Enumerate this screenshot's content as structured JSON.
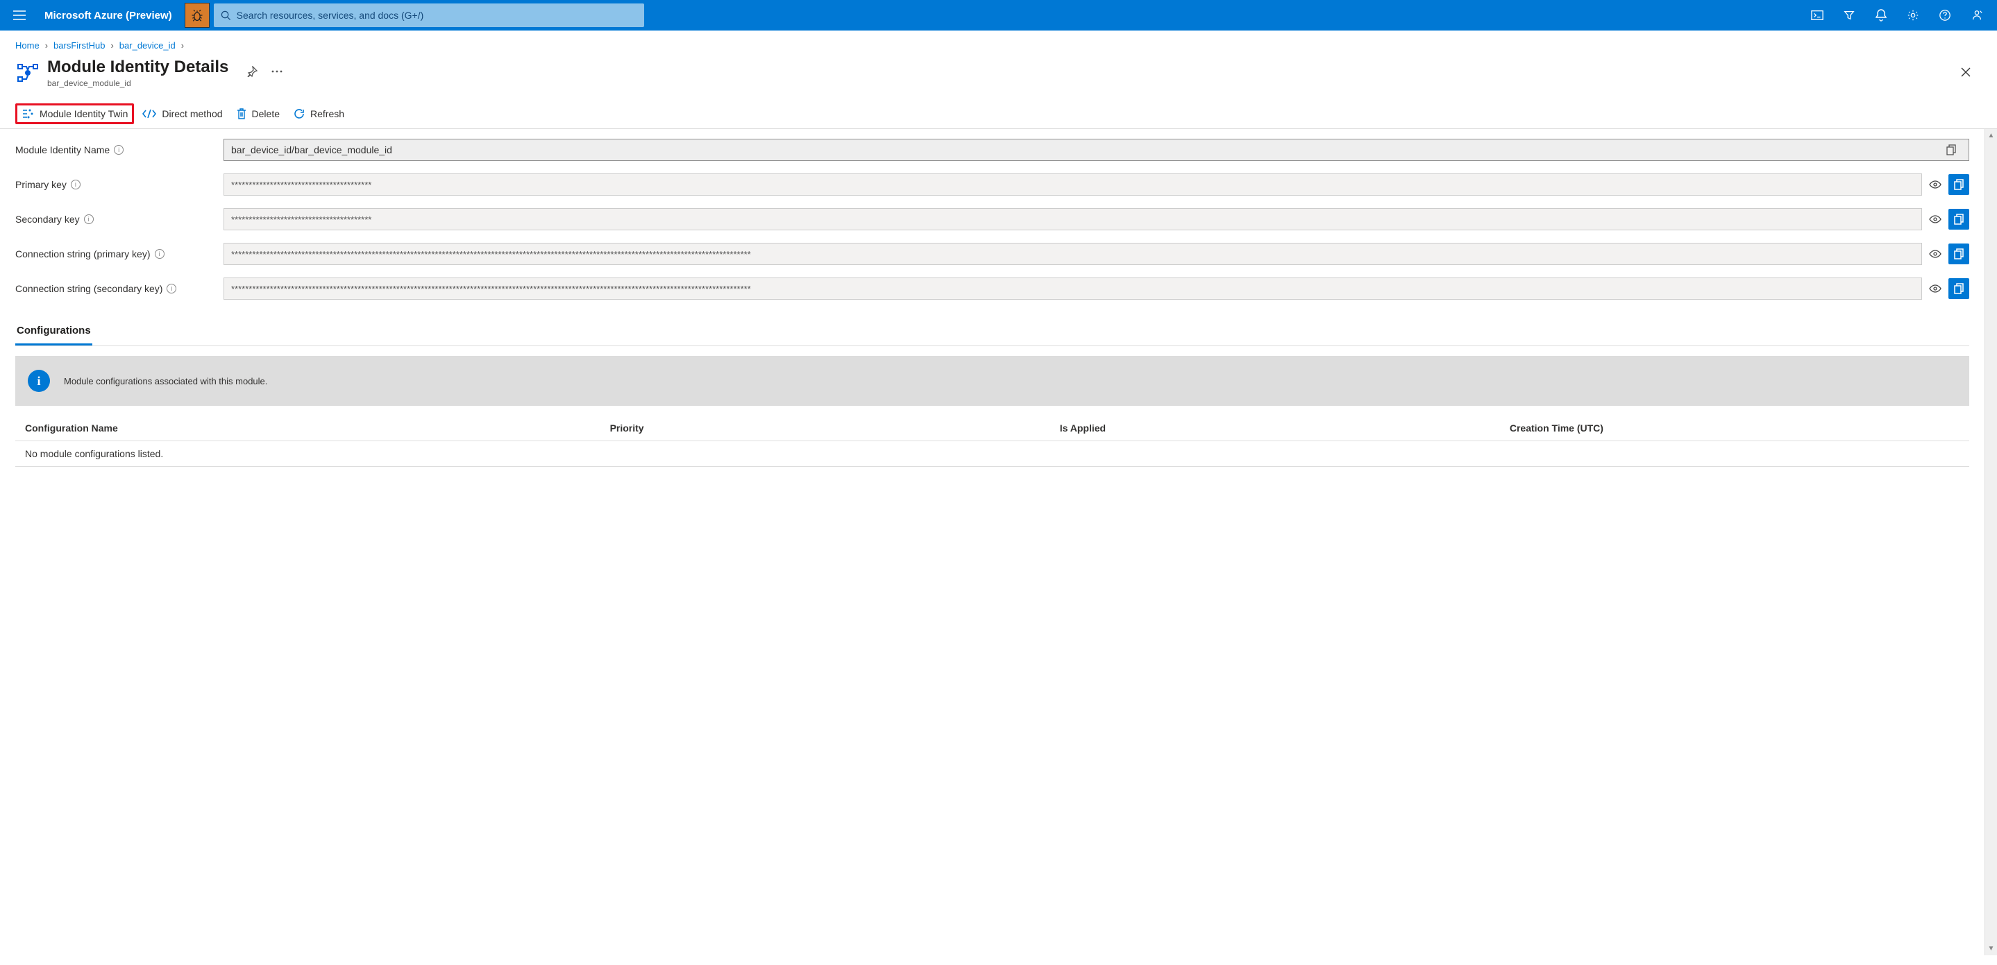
{
  "brand": "Microsoft Azure (Preview)",
  "search": {
    "placeholder": "Search resources, services, and docs (G+/)"
  },
  "breadcrumb": {
    "home": "Home",
    "hub": "barsFirstHub",
    "device": "bar_device_id"
  },
  "page": {
    "title": "Module Identity Details",
    "subtitle": "bar_device_module_id"
  },
  "toolbar": {
    "twin": "Module Identity Twin",
    "direct": "Direct method",
    "delete": "Delete",
    "refresh": "Refresh"
  },
  "fields": {
    "module_name": {
      "label": "Module Identity Name",
      "value": "bar_device_id/bar_device_module_id"
    },
    "primary_key": {
      "label": "Primary key",
      "value": "****************************************"
    },
    "secondary_key": {
      "label": "Secondary key",
      "value": "****************************************"
    },
    "conn_primary": {
      "label": "Connection string (primary key)",
      "value": "****************************************************************************************************************************************************"
    },
    "conn_secondary": {
      "label": "Connection string (secondary key)",
      "value": "****************************************************************************************************************************************************"
    }
  },
  "config": {
    "tab": "Configurations",
    "banner": "Module configurations associated with this module.",
    "columns": {
      "name": "Configuration Name",
      "priority": "Priority",
      "applied": "Is Applied",
      "created": "Creation Time (UTC)"
    },
    "empty": "No module configurations listed."
  }
}
